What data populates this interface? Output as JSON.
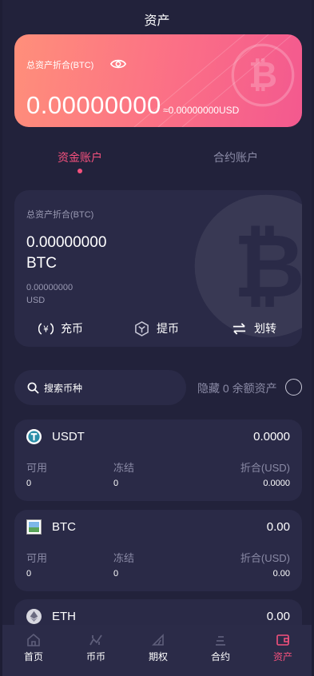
{
  "header": {
    "title": "资产"
  },
  "total": {
    "label": "总资产折合(BTC)",
    "amount": "0.00000000",
    "usd": "≈0.00000000USD"
  },
  "tabs": [
    {
      "label": "资金账户",
      "active": true
    },
    {
      "label": "合约账户",
      "active": false
    }
  ],
  "account": {
    "label": "总资产折合(BTC)",
    "amount": "0.00000000 BTC",
    "usd_value": "0.00000000",
    "usd_unit": "USD",
    "actions": [
      {
        "label": "充币",
        "icon": "deposit-icon"
      },
      {
        "label": "提币",
        "icon": "withdraw-icon"
      },
      {
        "label": "划转",
        "icon": "transfer-icon"
      }
    ]
  },
  "search": {
    "placeholder": "搜索币种",
    "hide_label": "隐藏 0 余额资产"
  },
  "coin_headers": {
    "available": "可用",
    "frozen": "冻结",
    "converted": "折合(USD)"
  },
  "coins": [
    {
      "name": "USDT",
      "balance": "0.0000",
      "available": "0",
      "frozen": "0",
      "converted": "0.0000",
      "icon": "tether-icon"
    },
    {
      "name": "BTC",
      "balance": "0.00",
      "available": "0",
      "frozen": "0",
      "converted": "0.00",
      "icon": "broken-image-icon"
    },
    {
      "name": "ETH",
      "balance": "0.00",
      "icon": "ethereum-icon"
    }
  ],
  "nav": [
    {
      "label": "首页",
      "icon": "home-icon",
      "active": false
    },
    {
      "label": "币币",
      "icon": "spot-trade-icon",
      "active": false
    },
    {
      "label": "期权",
      "icon": "options-icon",
      "active": false
    },
    {
      "label": "合约",
      "icon": "contract-icon",
      "active": false
    },
    {
      "label": "资产",
      "icon": "wallet-icon",
      "active": true
    }
  ],
  "colors": {
    "accent": "#f4517d",
    "background": "#22223b",
    "card": "#2a2a47",
    "muted": "#8b8ba6"
  }
}
